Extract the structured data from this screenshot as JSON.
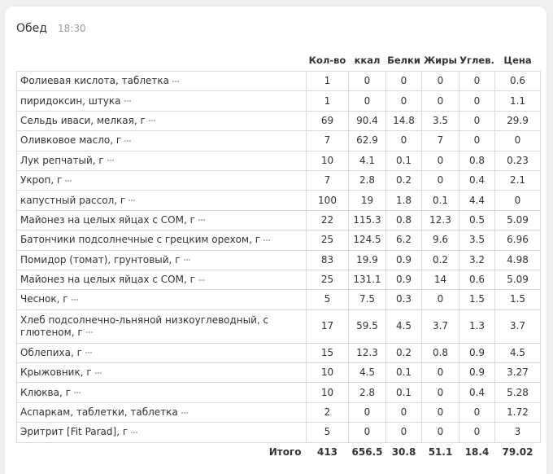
{
  "meal": {
    "title": "Обед",
    "time": "18:30"
  },
  "columns": {
    "qty": "Кол-во",
    "kcal": "ккал",
    "protein": "Белки",
    "fat": "Жиры",
    "carbs": "Углев.",
    "price": "Цена"
  },
  "rows": [
    {
      "name": "Фолиевая кислота, таблетка",
      "qty": "1",
      "kcal": "0",
      "protein": "0",
      "fat": "0",
      "carbs": "0",
      "price": "0.6"
    },
    {
      "name": "пиридоксин, штука",
      "qty": "1",
      "kcal": "0",
      "protein": "0",
      "fat": "0",
      "carbs": "0",
      "price": "1.1"
    },
    {
      "name": "Сельдь иваси, мелкая, г",
      "qty": "69",
      "kcal": "90.4",
      "protein": "14.8",
      "fat": "3.5",
      "carbs": "0",
      "price": "29.9"
    },
    {
      "name": "Оливковое масло, г",
      "qty": "7",
      "kcal": "62.9",
      "protein": "0",
      "fat": "7",
      "carbs": "0",
      "price": "0"
    },
    {
      "name": "Лук репчатый, г",
      "qty": "10",
      "kcal": "4.1",
      "protein": "0.1",
      "fat": "0",
      "carbs": "0.8",
      "price": "0.23"
    },
    {
      "name": "Укроп, г",
      "qty": "7",
      "kcal": "2.8",
      "protein": "0.2",
      "fat": "0",
      "carbs": "0.4",
      "price": "2.1"
    },
    {
      "name": "капустный рассол, г",
      "qty": "100",
      "kcal": "19",
      "protein": "1.8",
      "fat": "0.1",
      "carbs": "4.4",
      "price": "0"
    },
    {
      "name": "Майонез на целых яйцах с СОМ, г",
      "qty": "22",
      "kcal": "115.3",
      "protein": "0.8",
      "fat": "12.3",
      "carbs": "0.5",
      "price": "5.09"
    },
    {
      "name": "Батончики подсолнечные с грецким орехом, г",
      "qty": "25",
      "kcal": "124.5",
      "protein": "6.2",
      "fat": "9.6",
      "carbs": "3.5",
      "price": "6.96"
    },
    {
      "name": "Помидор (томат), грунтовый, г",
      "qty": "83",
      "kcal": "19.9",
      "protein": "0.9",
      "fat": "0.2",
      "carbs": "3.2",
      "price": "4.98"
    },
    {
      "name": "Майонез на целых яйцах с СОМ, г",
      "qty": "25",
      "kcal": "131.1",
      "protein": "0.9",
      "fat": "14",
      "carbs": "0.6",
      "price": "5.09"
    },
    {
      "name": "Чеснок, г",
      "qty": "5",
      "kcal": "7.5",
      "protein": "0.3",
      "fat": "0",
      "carbs": "1.5",
      "price": "1.5"
    },
    {
      "name": "Хлеб подсолнечно-льняной низкоуглеводный, с глютеном, г",
      "qty": "17",
      "kcal": "59.5",
      "protein": "4.5",
      "fat": "3.7",
      "carbs": "1.3",
      "price": "3.7",
      "tall": true
    },
    {
      "name": "Облепиха, г",
      "qty": "15",
      "kcal": "12.3",
      "protein": "0.2",
      "fat": "0.8",
      "carbs": "0.9",
      "price": "4.5"
    },
    {
      "name": "Крыжовник, г",
      "qty": "10",
      "kcal": "4.5",
      "protein": "0.1",
      "fat": "0",
      "carbs": "0.9",
      "price": "3.27"
    },
    {
      "name": "Клюква, г",
      "qty": "10",
      "kcal": "2.8",
      "protein": "0.1",
      "fat": "0",
      "carbs": "0.4",
      "price": "5.28"
    },
    {
      "name": "Аспаркам, таблетки, таблетка",
      "qty": "2",
      "kcal": "0",
      "protein": "0",
      "fat": "0",
      "carbs": "0",
      "price": "1.72"
    },
    {
      "name": "Эритрит [Fit Parad], г",
      "qty": "5",
      "kcal": "0",
      "protein": "0",
      "fat": "0",
      "carbs": "0",
      "price": "3"
    }
  ],
  "total": {
    "label": "Итого",
    "qty": "413",
    "kcal": "656.5",
    "protein": "30.8",
    "fat": "51.1",
    "carbs": "18.4",
    "price": "79.02"
  },
  "icons": {
    "row_menu": "more-dots-icon"
  }
}
